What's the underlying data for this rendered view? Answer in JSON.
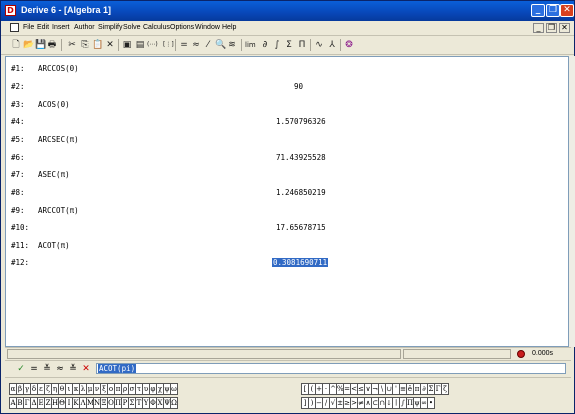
{
  "window": {
    "title": "Derive 6 - [Algebra 1]"
  },
  "menu": [
    "File",
    "Edit",
    "Insert",
    "Author",
    "Simplify",
    "Solve",
    "Calculus",
    "Options",
    "Window",
    "Help"
  ],
  "toolbar_icons": [
    "new-document",
    "open-folder",
    "save",
    "print",
    "cut",
    "copy",
    "paste",
    "delete",
    "author-text",
    "author-vector",
    "author-matrix",
    "author-grid",
    "simplify-equals",
    "approximate",
    "solve",
    "substitute",
    "expand",
    "limit",
    "derivative",
    "integral",
    "sum",
    "product",
    "plot-2d",
    "plot-3d",
    "derive-logo"
  ],
  "toolbar_glyphs": [
    "🗋",
    "📂",
    "💾",
    "🖶",
    "✂",
    "⎘",
    "📋",
    "✕",
    "▣",
    "▤",
    "(⋯)",
    "[⋮]",
    "=",
    "≈",
    "⁄",
    "🔍",
    "≋",
    "lim",
    "∂",
    "∫",
    "Σ",
    "Π",
    "∿",
    "⅄",
    "❂"
  ],
  "algebra": {
    "lines": [
      {
        "label": "#1:",
        "text": "ARCCOS(0)",
        "kind": "input"
      },
      {
        "label": "#2:",
        "text": "90",
        "kind": "result"
      },
      {
        "label": "#3:",
        "text": "ACOS(0)",
        "kind": "input"
      },
      {
        "label": "#4:",
        "text": "1.570796326",
        "kind": "result"
      },
      {
        "label": "#5:",
        "text": "ARCSEC(π)",
        "kind": "input"
      },
      {
        "label": "#6:",
        "text": "71.43925528",
        "kind": "result"
      },
      {
        "label": "#7:",
        "text": "ASEC(π)",
        "kind": "input"
      },
      {
        "label": "#8:",
        "text": "1.246850219",
        "kind": "result"
      },
      {
        "label": "#9:",
        "text": "ARCCOT(π)",
        "kind": "input"
      },
      {
        "label": "#10:",
        "text": "17.65678715",
        "kind": "result"
      },
      {
        "label": "#11:",
        "text": "ACOT(π)",
        "kind": "input"
      },
      {
        "label": "#12:",
        "text": "0.3081690711",
        "kind": "result-selected"
      }
    ]
  },
  "status": {
    "time": "0.000s"
  },
  "entry": {
    "value": "ACOT(pi)",
    "buttons": [
      "✓",
      "=",
      "≚",
      "≈",
      "≚",
      "✕"
    ]
  },
  "greek_upper_lower": {
    "lower": [
      "α",
      "β",
      "γ",
      "δ",
      "ε",
      "ζ",
      "η",
      "θ",
      "ι",
      "κ",
      "λ",
      "μ",
      "ν",
      "ξ",
      "ο",
      "π",
      "ρ",
      "σ",
      "τ",
      "υ",
      "φ",
      "χ",
      "ψ",
      "ω"
    ],
    "upper": [
      "Α",
      "Β",
      "Γ",
      "Δ",
      "Ε",
      "Ζ",
      "Η",
      "Θ",
      "Ι",
      "Κ",
      "Λ",
      "Μ",
      "Ν",
      "Ξ",
      "Ο",
      "Π",
      "Ρ",
      "Σ",
      "Τ",
      "Υ",
      "Φ",
      "Χ",
      "Ψ",
      "Ω"
    ]
  },
  "symbols": {
    "row1": [
      "[",
      "(",
      "+",
      "·",
      "^",
      "%",
      "=",
      "<",
      "≤",
      "∨",
      "¬",
      "\\",
      "∪",
      "'",
      "≡",
      "ê",
      "π",
      "∂",
      "Σ",
      "Γ",
      "ζ"
    ],
    "row2": [
      "]",
      ")",
      "−",
      "/",
      "√",
      "±",
      "≥",
      ">",
      "≠",
      "∧",
      "⊂",
      "∩",
      "↓",
      "∣",
      "∫",
      "Π",
      "ψ",
      "∞",
      "•"
    ]
  },
  "colors": {
    "titlebar": "#0a5fd8",
    "selection": "#316ac5"
  }
}
